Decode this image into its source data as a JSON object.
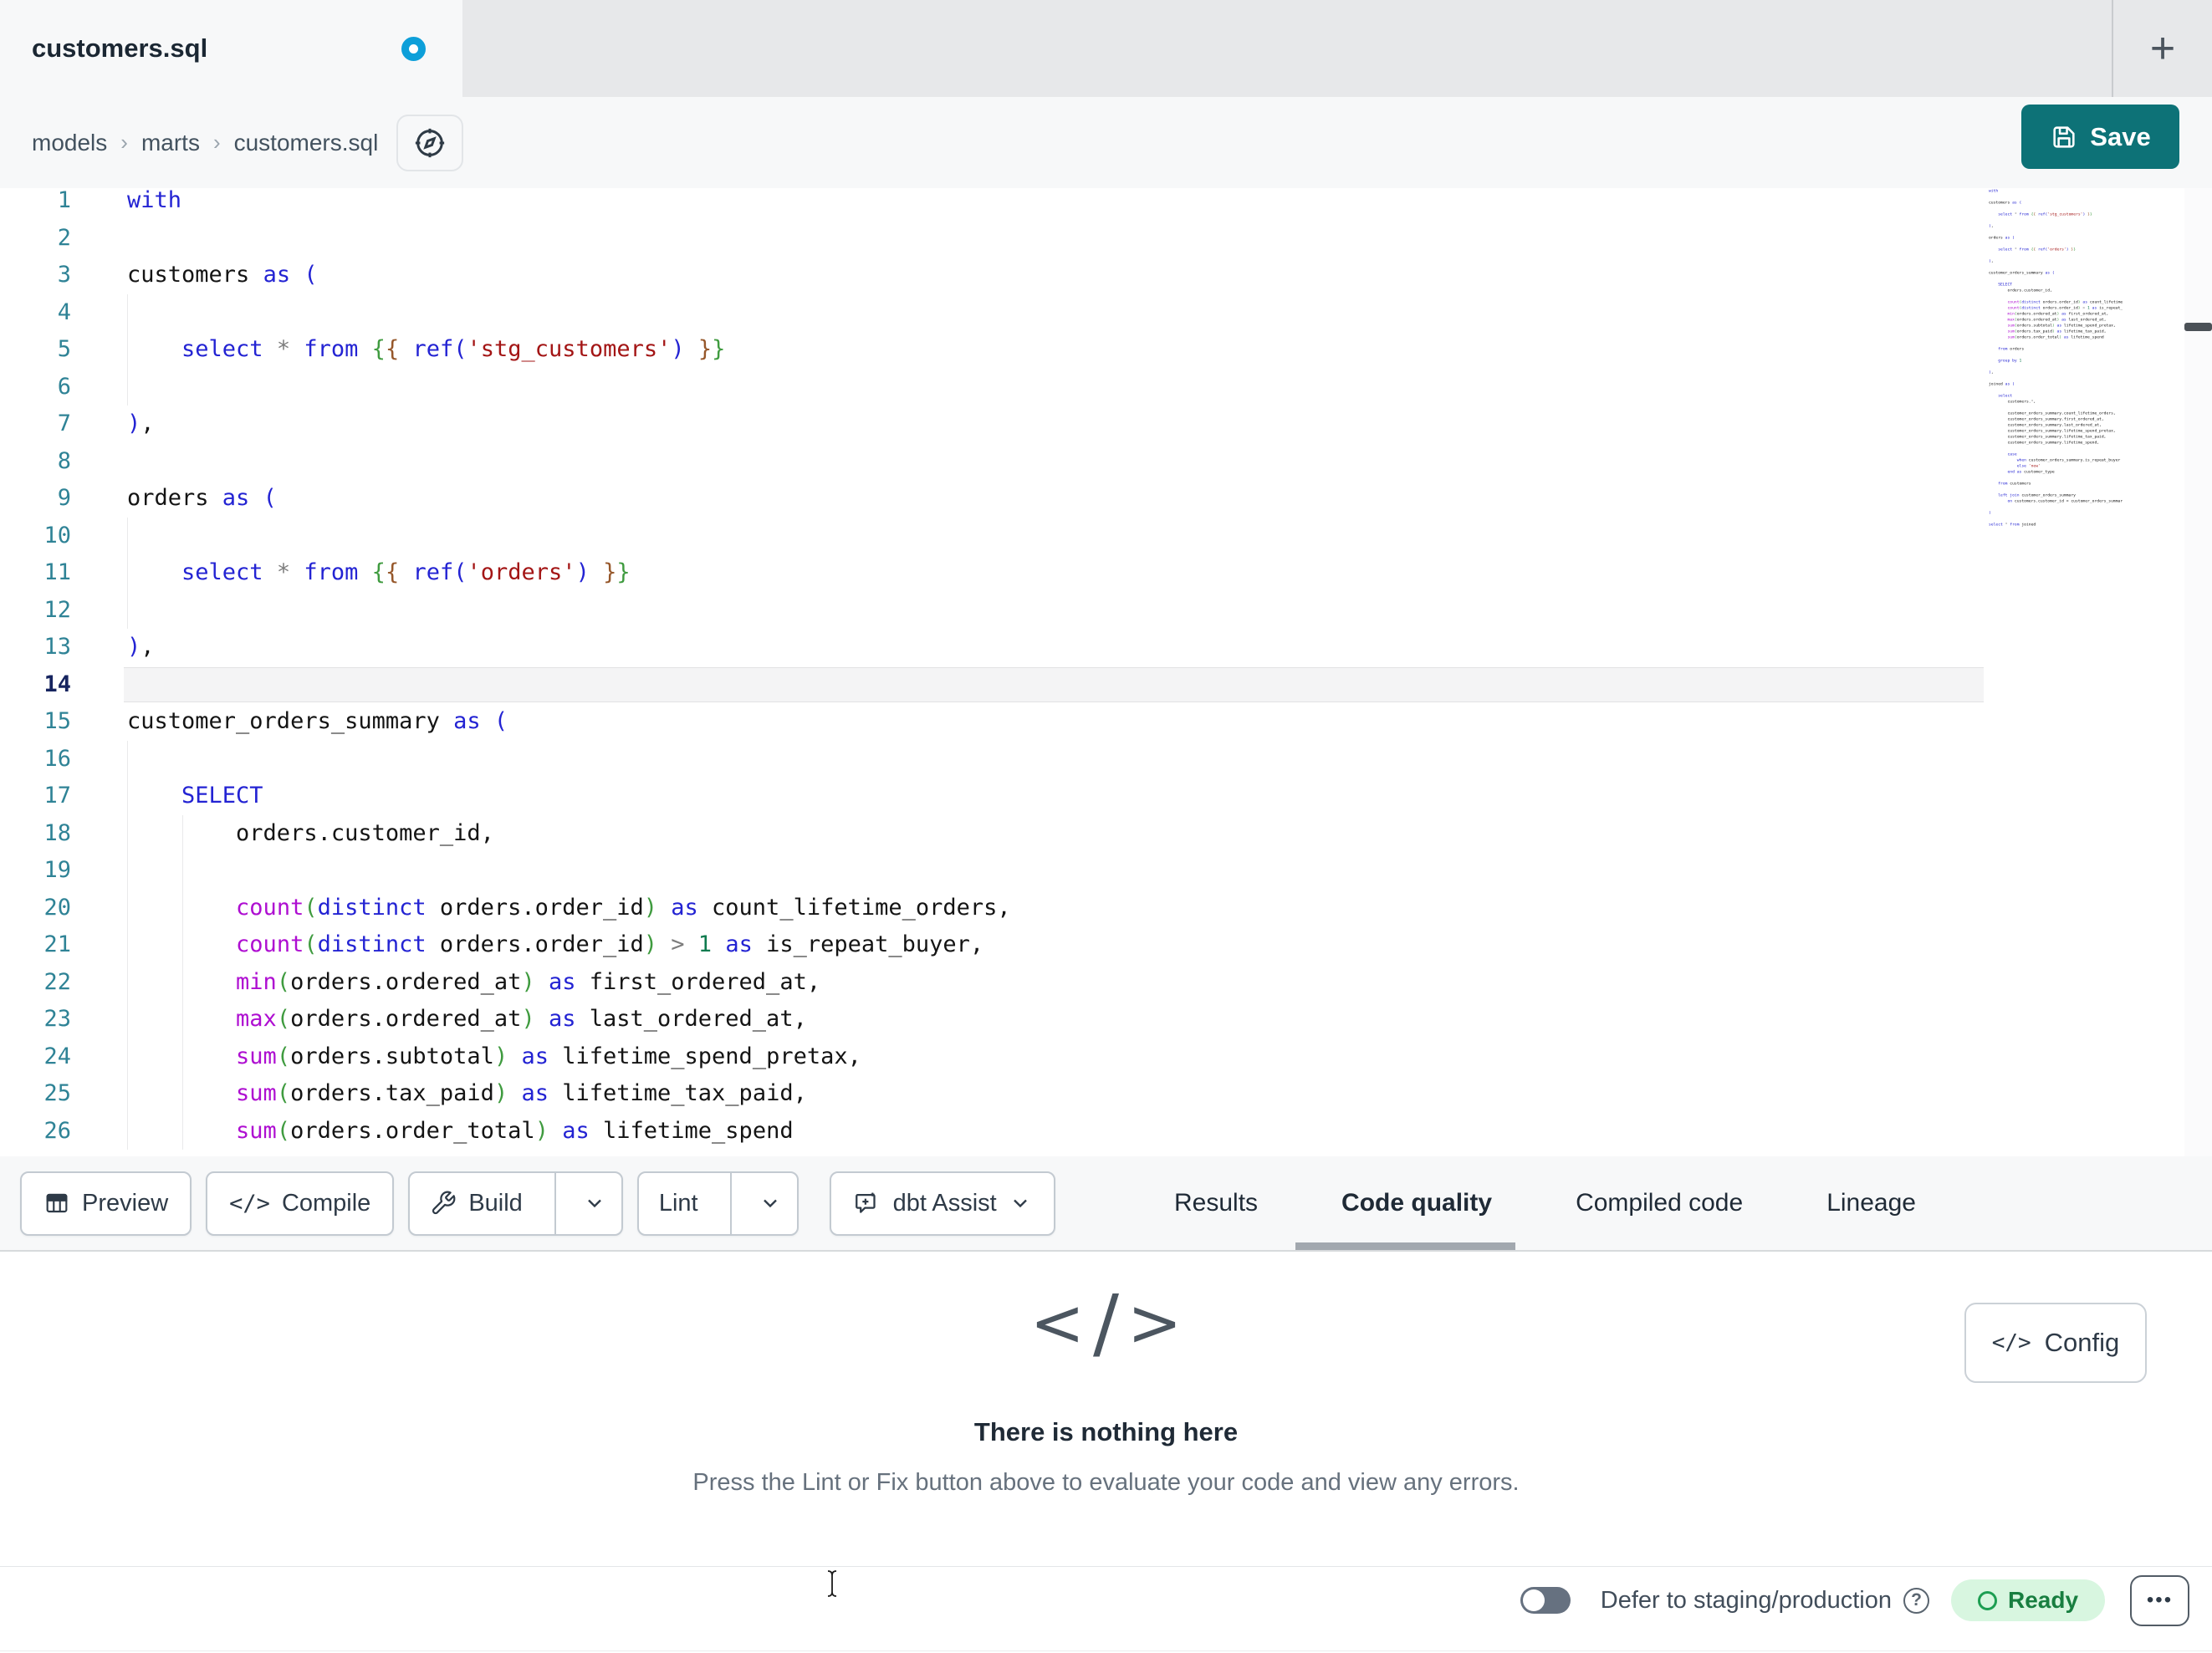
{
  "colors": {
    "accent-teal": "#0d7277",
    "dot-blue": "#0d9fd9",
    "ready-bg": "#d8f6e0",
    "ready-text": "#187e40",
    "kw": "#2323d3",
    "fn": "#ae0ed1",
    "str": "#a31515",
    "num": "#0f7b4f",
    "brg": "#3f9b3f",
    "bro": "#96572a",
    "op": "#7d7d7d",
    "txt": "#141414",
    "gutter": "#2f8396",
    "gutter-active": "#16245f"
  },
  "tab_bar": {
    "title": "customers.sql",
    "new_tab_label": "+"
  },
  "breadcrumb": {
    "items": [
      "models",
      "marts",
      "customers.sql"
    ],
    "separator": "›"
  },
  "header": {
    "save_label": "Save"
  },
  "toolbar": {
    "preview_label": "Preview",
    "compile_label": "Compile",
    "compile_icon": "</>",
    "build_label": "Build",
    "lint_label": "Lint",
    "assist_label": "dbt Assist"
  },
  "panel_tabs": {
    "results": "Results",
    "code_quality": "Code quality",
    "compiled_code": "Compiled code",
    "lineage": "Lineage",
    "active": "Code quality"
  },
  "empty_state": {
    "icon_left": "<",
    "icon_slash": "/",
    "icon_right": ">",
    "title": "There is nothing here",
    "subtitle": "Press the Lint or Fix button above to evaluate your code and view any errors."
  },
  "config": {
    "label": "Config",
    "icon": "</>"
  },
  "status_bar": {
    "defer_label": "Defer to staging/production",
    "help": "?",
    "ready_label": "Ready",
    "more_label": "•••"
  },
  "editor": {
    "visible_count": 26,
    "active_line": 14,
    "lines": [
      {
        "g": 0,
        "tokens": [
          [
            "k",
            "with"
          ]
        ]
      },
      {
        "g": 0,
        "tokens": []
      },
      {
        "g": 0,
        "tokens": [
          [
            "t",
            "customers "
          ],
          [
            "k",
            "as"
          ],
          [
            "t",
            " "
          ],
          [
            "k",
            "("
          ]
        ]
      },
      {
        "g": 1,
        "tokens": []
      },
      {
        "g": 1,
        "tokens": [
          [
            "t",
            "    "
          ],
          [
            "k",
            "select"
          ],
          [
            "t",
            " "
          ],
          [
            "y",
            "*"
          ],
          [
            "t",
            " "
          ],
          [
            "k",
            "from"
          ],
          [
            "t",
            " "
          ],
          [
            "g",
            "{"
          ],
          [
            "o",
            "{"
          ],
          [
            "t",
            " "
          ],
          [
            "k",
            "ref"
          ],
          [
            "k",
            "("
          ],
          [
            "s",
            "'stg_customers'"
          ],
          [
            "k",
            ")"
          ],
          [
            "t",
            " "
          ],
          [
            "o",
            "}"
          ],
          [
            "g",
            "}"
          ]
        ]
      },
      {
        "g": 1,
        "tokens": []
      },
      {
        "g": 0,
        "tokens": [
          [
            "k",
            ")"
          ],
          [
            "t",
            ","
          ]
        ]
      },
      {
        "g": 0,
        "tokens": []
      },
      {
        "g": 0,
        "tokens": [
          [
            "t",
            "orders "
          ],
          [
            "k",
            "as"
          ],
          [
            "t",
            " "
          ],
          [
            "k",
            "("
          ]
        ]
      },
      {
        "g": 1,
        "tokens": []
      },
      {
        "g": 1,
        "tokens": [
          [
            "t",
            "    "
          ],
          [
            "k",
            "select"
          ],
          [
            "t",
            " "
          ],
          [
            "y",
            "*"
          ],
          [
            "t",
            " "
          ],
          [
            "k",
            "from"
          ],
          [
            "t",
            " "
          ],
          [
            "g",
            "{"
          ],
          [
            "o",
            "{"
          ],
          [
            "t",
            " "
          ],
          [
            "k",
            "ref"
          ],
          [
            "k",
            "("
          ],
          [
            "s",
            "'orders'"
          ],
          [
            "k",
            ")"
          ],
          [
            "t",
            " "
          ],
          [
            "o",
            "}"
          ],
          [
            "g",
            "}"
          ]
        ]
      },
      {
        "g": 1,
        "tokens": []
      },
      {
        "g": 0,
        "tokens": [
          [
            "k",
            ")"
          ],
          [
            "t",
            ","
          ]
        ]
      },
      {
        "g": 0,
        "tokens": []
      },
      {
        "g": 0,
        "tokens": [
          [
            "t",
            "customer_orders_summary "
          ],
          [
            "k",
            "as"
          ],
          [
            "t",
            " "
          ],
          [
            "k",
            "("
          ]
        ]
      },
      {
        "g": 1,
        "tokens": []
      },
      {
        "g": 1,
        "tokens": [
          [
            "t",
            "    "
          ],
          [
            "k",
            "SELECT"
          ]
        ]
      },
      {
        "g": 2,
        "tokens": [
          [
            "t",
            "        orders.customer_id,"
          ]
        ]
      },
      {
        "g": 2,
        "tokens": []
      },
      {
        "g": 2,
        "tokens": [
          [
            "t",
            "        "
          ],
          [
            "f",
            "count"
          ],
          [
            "g",
            "("
          ],
          [
            "k",
            "distinct"
          ],
          [
            "t",
            " orders.order_id"
          ],
          [
            "g",
            ")"
          ],
          [
            "t",
            " "
          ],
          [
            "k",
            "as"
          ],
          [
            "t",
            " count_lifetime_orders,"
          ]
        ]
      },
      {
        "g": 2,
        "tokens": [
          [
            "t",
            "        "
          ],
          [
            "f",
            "count"
          ],
          [
            "g",
            "("
          ],
          [
            "k",
            "distinct"
          ],
          [
            "t",
            " orders.order_id"
          ],
          [
            "g",
            ")"
          ],
          [
            "t",
            " "
          ],
          [
            "y",
            ">"
          ],
          [
            "t",
            " "
          ],
          [
            "n",
            "1"
          ],
          [
            "t",
            " "
          ],
          [
            "k",
            "as"
          ],
          [
            "t",
            " is_repeat_buyer,"
          ]
        ]
      },
      {
        "g": 2,
        "tokens": [
          [
            "t",
            "        "
          ],
          [
            "f",
            "min"
          ],
          [
            "g",
            "("
          ],
          [
            "t",
            "orders.ordered_at"
          ],
          [
            "g",
            ")"
          ],
          [
            "t",
            " "
          ],
          [
            "k",
            "as"
          ],
          [
            "t",
            " first_ordered_at,"
          ]
        ]
      },
      {
        "g": 2,
        "tokens": [
          [
            "t",
            "        "
          ],
          [
            "f",
            "max"
          ],
          [
            "g",
            "("
          ],
          [
            "t",
            "orders.ordered_at"
          ],
          [
            "g",
            ")"
          ],
          [
            "t",
            " "
          ],
          [
            "k",
            "as"
          ],
          [
            "t",
            " last_ordered_at,"
          ]
        ]
      },
      {
        "g": 2,
        "tokens": [
          [
            "t",
            "        "
          ],
          [
            "f",
            "sum"
          ],
          [
            "g",
            "("
          ],
          [
            "t",
            "orders.subtotal"
          ],
          [
            "g",
            ")"
          ],
          [
            "t",
            " "
          ],
          [
            "k",
            "as"
          ],
          [
            "t",
            " lifetime_spend_pretax,"
          ]
        ]
      },
      {
        "g": 2,
        "tokens": [
          [
            "t",
            "        "
          ],
          [
            "f",
            "sum"
          ],
          [
            "g",
            "("
          ],
          [
            "t",
            "orders.tax_paid"
          ],
          [
            "g",
            ")"
          ],
          [
            "t",
            " "
          ],
          [
            "k",
            "as"
          ],
          [
            "t",
            " lifetime_tax_paid,"
          ]
        ]
      },
      {
        "g": 2,
        "tokens": [
          [
            "t",
            "        "
          ],
          [
            "f",
            "sum"
          ],
          [
            "g",
            "("
          ],
          [
            "t",
            "orders.order_total"
          ],
          [
            "g",
            ")"
          ],
          [
            "t",
            " "
          ],
          [
            "k",
            "as"
          ],
          [
            "t",
            " lifetime_spend"
          ]
        ]
      },
      {
        "g": 0,
        "tokens": []
      },
      {
        "g": 0,
        "tokens": [
          [
            "t",
            "    "
          ],
          [
            "k",
            "from"
          ],
          [
            "t",
            " orders"
          ]
        ]
      },
      {
        "g": 0,
        "tokens": []
      },
      {
        "g": 0,
        "tokens": [
          [
            "t",
            "    "
          ],
          [
            "k",
            "group by"
          ],
          [
            "t",
            " "
          ],
          [
            "n",
            "1"
          ]
        ]
      },
      {
        "g": 0,
        "tokens": []
      },
      {
        "g": 0,
        "tokens": [
          [
            "k",
            ")"
          ],
          [
            "t",
            ","
          ]
        ]
      },
      {
        "g": 0,
        "tokens": []
      },
      {
        "g": 0,
        "tokens": [
          [
            "t",
            "joined "
          ],
          [
            "k",
            "as"
          ],
          [
            "t",
            " "
          ],
          [
            "k",
            "("
          ]
        ]
      },
      {
        "g": 0,
        "tokens": []
      },
      {
        "g": 0,
        "tokens": [
          [
            "t",
            "    "
          ],
          [
            "k",
            "select"
          ]
        ]
      },
      {
        "g": 0,
        "tokens": [
          [
            "t",
            "        customers."
          ],
          [
            "y",
            "*"
          ],
          [
            "t",
            ","
          ]
        ]
      },
      {
        "g": 0,
        "tokens": []
      },
      {
        "g": 0,
        "tokens": [
          [
            "t",
            "        customer_orders_summary.count_lifetime_orders,"
          ]
        ]
      },
      {
        "g": 0,
        "tokens": [
          [
            "t",
            "        customer_orders_summary.first_ordered_at,"
          ]
        ]
      },
      {
        "g": 0,
        "tokens": [
          [
            "t",
            "        customer_orders_summary.last_ordered_at,"
          ]
        ]
      },
      {
        "g": 0,
        "tokens": [
          [
            "t",
            "        customer_orders_summary.lifetime_spend_pretax,"
          ]
        ]
      },
      {
        "g": 0,
        "tokens": [
          [
            "t",
            "        customer_orders_summary.lifetime_tax_paid,"
          ]
        ]
      },
      {
        "g": 0,
        "tokens": [
          [
            "t",
            "        customer_orders_summary.lifetime_spend,"
          ]
        ]
      },
      {
        "g": 0,
        "tokens": []
      },
      {
        "g": 0,
        "tokens": [
          [
            "t",
            "        "
          ],
          [
            "k",
            "case"
          ]
        ]
      },
      {
        "g": 0,
        "tokens": [
          [
            "t",
            "            "
          ],
          [
            "k",
            "when"
          ],
          [
            "t",
            " customer_orders_summary.is_repeat_buyer "
          ],
          [
            "k",
            "then"
          ],
          [
            "t",
            " "
          ],
          [
            "s",
            "'returning'"
          ]
        ]
      },
      {
        "g": 0,
        "tokens": [
          [
            "t",
            "            "
          ],
          [
            "k",
            "else"
          ],
          [
            "t",
            " "
          ],
          [
            "s",
            "'new'"
          ]
        ]
      },
      {
        "g": 0,
        "tokens": [
          [
            "t",
            "        "
          ],
          [
            "k",
            "end"
          ],
          [
            "t",
            " "
          ],
          [
            "k",
            "as"
          ],
          [
            "t",
            " customer_type"
          ]
        ]
      },
      {
        "g": 0,
        "tokens": []
      },
      {
        "g": 0,
        "tokens": [
          [
            "t",
            "    "
          ],
          [
            "k",
            "from"
          ],
          [
            "t",
            " customers"
          ]
        ]
      },
      {
        "g": 0,
        "tokens": []
      },
      {
        "g": 0,
        "tokens": [
          [
            "t",
            "    "
          ],
          [
            "k",
            "left join"
          ],
          [
            "t",
            " customer_orders_summary"
          ]
        ]
      },
      {
        "g": 0,
        "tokens": [
          [
            "t",
            "        "
          ],
          [
            "k",
            "on"
          ],
          [
            "t",
            " customers.customer_id = customer_orders_summary.customer_id"
          ]
        ]
      },
      {
        "g": 0,
        "tokens": []
      },
      {
        "g": 0,
        "tokens": [
          [
            "k",
            ")"
          ]
        ]
      },
      {
        "g": 0,
        "tokens": []
      },
      {
        "g": 0,
        "tokens": [
          [
            "k",
            "select"
          ],
          [
            "t",
            " "
          ],
          [
            "y",
            "*"
          ],
          [
            "t",
            " "
          ],
          [
            "k",
            "from"
          ],
          [
            "t",
            " joined"
          ]
        ]
      }
    ]
  }
}
